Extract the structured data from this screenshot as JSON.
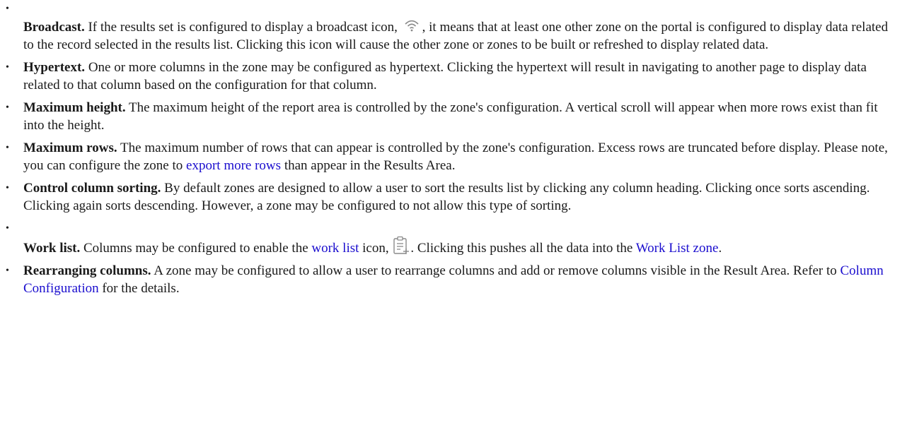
{
  "items": [
    {
      "term": "Broadcast.",
      "before": " If the results set is configured to display a broadcast icon, ",
      "icon": "broadcast-icon",
      "after": ", it means that at least one other zone on the portal is configured to display data related to the record selected in the results list. Clicking this icon will cause the other zone or zones to be built or refreshed to display related data."
    },
    {
      "term": "Hypertext.",
      "text": " One or more columns in the zone may be configured as hypertext. Clicking the hypertext will result in navigating to another page to display data related to that column based on the configuration for that column."
    },
    {
      "term": "Maximum height.",
      "text": " The maximum height of the report area is controlled by the zone's configuration. A vertical scroll will appear when more rows exist than fit into the height."
    },
    {
      "term": "Maximum rows.",
      "before": " The maximum number of rows that can appear is controlled by the zone's configuration. Excess rows are truncated before display. Please note, you can configure the zone to ",
      "link": "export more rows",
      "after": " than appear in the Results Area."
    },
    {
      "term": "Control column sorting.",
      "text": " By default zones are designed to allow a user to sort the results list by clicking any column heading. Clicking once sorts ascending. Clicking again sorts descending. However, a zone may be configured to not allow this type of sorting."
    },
    {
      "term": "Work list.",
      "before": " Columns may be configured to enable the ",
      "link1": "work list",
      "middle": " icon, ",
      "icon": "work-list-icon",
      "after": ". Clicking this pushes all the data into the ",
      "link2": "Work List zone",
      "end": "."
    },
    {
      "term": "Rearranging columns.",
      "before": " A zone may be configured to allow a user to rearrange columns and add or remove columns visible in the Result Area. Refer to ",
      "link": "Column Configuration",
      "after": " for the details."
    }
  ],
  "bullet_glyph": "•",
  "colors": {
    "text": "#1a1a1a",
    "link": "#1a0dce",
    "icon": "#8a8a8a"
  }
}
